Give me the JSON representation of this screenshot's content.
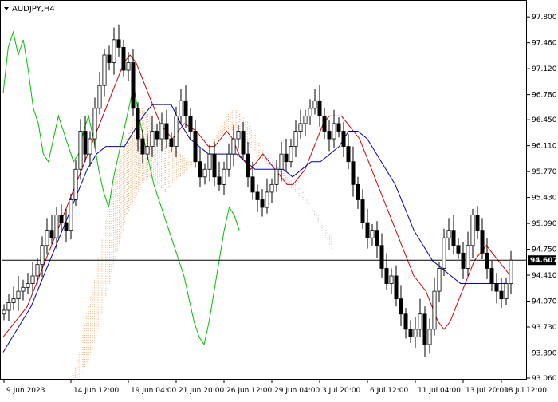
{
  "window": {
    "symbol_title": "AUDJPY,H4",
    "menu_icon": "triangle-down-icon"
  },
  "chart_data": {
    "type": "candlestick",
    "title": "AUDJPY,H4",
    "ylim": [
      93.06,
      97.98
    ],
    "y_ticks": [
      "97.800",
      "97.460",
      "97.120",
      "96.780",
      "96.450",
      "96.110",
      "95.770",
      "95.430",
      "95.090",
      "94.750",
      "94.410",
      "94.070",
      "93.730",
      "93.390",
      "93.060"
    ],
    "x_ticks": [
      "9 Jun 2023",
      "14 Jun 12:00",
      "19 Jun 04:00",
      "21 Jun 20:00",
      "26 Jun 12:00",
      "29 Jun 04:00",
      "3 Jul 20:00",
      "6 Jul 12:00",
      "11 Jul 04:00",
      "13 Jul 20:00",
      "18 Jul 12:00"
    ],
    "x_tick_index": [
      0,
      14,
      26,
      36,
      46,
      56,
      66,
      76,
      86,
      96,
      104
    ],
    "current_price": 94.607,
    "current_price_label": "94.607",
    "candles_close": [
      93.95,
      94.05,
      94.1,
      94.2,
      94.25,
      94.3,
      94.4,
      94.55,
      94.8,
      95.0,
      94.9,
      95.2,
      95.1,
      95.0,
      95.4,
      95.8,
      96.3,
      96.0,
      96.2,
      96.6,
      96.9,
      97.3,
      97.2,
      97.5,
      97.4,
      97.1,
      97.2,
      96.6,
      96.2,
      96.0,
      96.1,
      96.3,
      96.2,
      96.4,
      96.2,
      96.1,
      96.5,
      96.7,
      96.5,
      96.3,
      95.9,
      95.7,
      95.8,
      96.0,
      95.7,
      95.6,
      95.8,
      96.0,
      96.2,
      96.3,
      96.0,
      95.7,
      95.5,
      95.4,
      95.3,
      95.5,
      95.6,
      95.8,
      96.0,
      95.9,
      96.1,
      96.3,
      96.4,
      96.5,
      96.6,
      96.7,
      96.5,
      96.3,
      96.2,
      96.4,
      96.3,
      96.1,
      95.9,
      95.6,
      95.4,
      95.1,
      94.9,
      95.0,
      94.8,
      94.5,
      94.3,
      94.4,
      94.1,
      93.9,
      93.7,
      93.6,
      93.7,
      93.9,
      93.5,
      93.7,
      94.2,
      94.5,
      94.9,
      95.0,
      94.8,
      94.7,
      94.5,
      94.8,
      95.2,
      95.0,
      94.7,
      94.5,
      94.3,
      94.2,
      94.1,
      94.3,
      94.607
    ],
    "tenkan_sen": [
      93.6,
      93.7,
      93.8,
      93.9,
      94.0,
      94.2,
      94.4,
      94.6,
      94.8,
      95.0,
      95.2,
      95.4,
      95.6,
      95.8,
      96.0,
      96.2,
      96.4,
      96.6,
      96.8,
      97.0,
      97.2,
      97.3,
      97.2,
      97.0,
      96.8,
      96.6,
      96.4,
      96.3,
      96.2,
      96.3,
      96.4,
      96.35,
      96.3,
      96.2,
      96.1,
      96.1,
      96.2,
      96.3,
      96.2,
      96.0,
      95.9,
      95.8,
      95.9,
      96.0,
      95.9,
      95.8,
      95.7,
      95.6,
      95.6,
      95.7,
      95.8,
      96.0,
      96.2,
      96.4,
      96.5,
      96.5,
      96.5,
      96.4,
      96.3,
      96.2,
      96.0,
      95.8,
      95.6,
      95.4,
      95.2,
      95.0,
      94.8,
      94.6,
      94.4,
      94.3,
      94.2,
      94.0,
      93.8,
      93.7,
      93.8,
      94.0,
      94.2,
      94.4,
      94.6,
      94.7,
      94.8,
      94.7,
      94.6,
      94.5,
      94.4
    ],
    "kijun_sen": [
      93.4,
      93.6,
      93.8,
      94.0,
      94.3,
      94.6,
      94.9,
      95.2,
      95.5,
      95.8,
      96.0,
      96.1,
      96.1,
      96.1,
      96.3,
      96.5,
      96.65,
      96.65,
      96.65,
      96.4,
      96.2,
      96.1,
      96.0,
      96.0,
      96.0,
      96.0,
      95.9,
      95.8,
      95.8,
      95.8,
      95.8,
      95.7,
      95.8,
      95.9,
      95.9,
      96.0,
      96.1,
      96.3,
      96.3,
      96.2,
      96.0,
      95.8,
      95.6,
      95.3,
      95.0,
      94.8,
      94.6,
      94.5,
      94.4,
      94.3,
      94.3,
      94.3,
      94.3,
      94.3,
      94.3
    ],
    "chikou_span": [
      96.8,
      97.4,
      97.6,
      97.3,
      97.5,
      97.1,
      96.6,
      96.4,
      96.0,
      95.9,
      96.2,
      96.5,
      96.3,
      96.1,
      95.9,
      96.0,
      96.3,
      96.5,
      96.2,
      95.8,
      95.5,
      95.3,
      95.7,
      96.0,
      96.3,
      96.6,
      96.9,
      96.5,
      96.2,
      95.9,
      95.6,
      95.4,
      95.2,
      95.0,
      94.8,
      94.6,
      94.4,
      94.1,
      93.8,
      93.6,
      93.5,
      93.8,
      94.2,
      94.6,
      95.0,
      95.3,
      95.2,
      95.0
    ],
    "cloud_upper": [
      93.1,
      93.5,
      94.0,
      94.5,
      95.0,
      95.5,
      95.9,
      96.2,
      96.5,
      96.6,
      96.5,
      96.3,
      96.2,
      96.1,
      96.0,
      95.9,
      95.9,
      96.0,
      96.1,
      96.3,
      96.5,
      96.6,
      96.5,
      96.4,
      96.2,
      96.0,
      95.9,
      95.8,
      95.7,
      95.6,
      95.5,
      95.3,
      95.2,
      95.0,
      94.9
    ],
    "cloud_lower": [
      93.0,
      93.1,
      93.3,
      93.6,
      94.0,
      94.4,
      94.8,
      95.2,
      95.4,
      95.6,
      95.7,
      95.6,
      95.5,
      95.6,
      95.7,
      95.8,
      95.9,
      96.0,
      96.1,
      96.2,
      96.3,
      96.3,
      96.2,
      96.1,
      96.0,
      95.9,
      95.8,
      95.7,
      95.6,
      95.5,
      95.4,
      95.3,
      95.1,
      94.9,
      94.7
    ],
    "colors": {
      "candle": "#000000",
      "tenkan_sen": "#d00000",
      "kijun_sen": "#0000b0",
      "chikou_span": "#00c000",
      "cloud_bull": "#f0a060",
      "cloud_bear": "#c0a0d0",
      "price_line": "#000000",
      "background": "#ffffff"
    }
  }
}
